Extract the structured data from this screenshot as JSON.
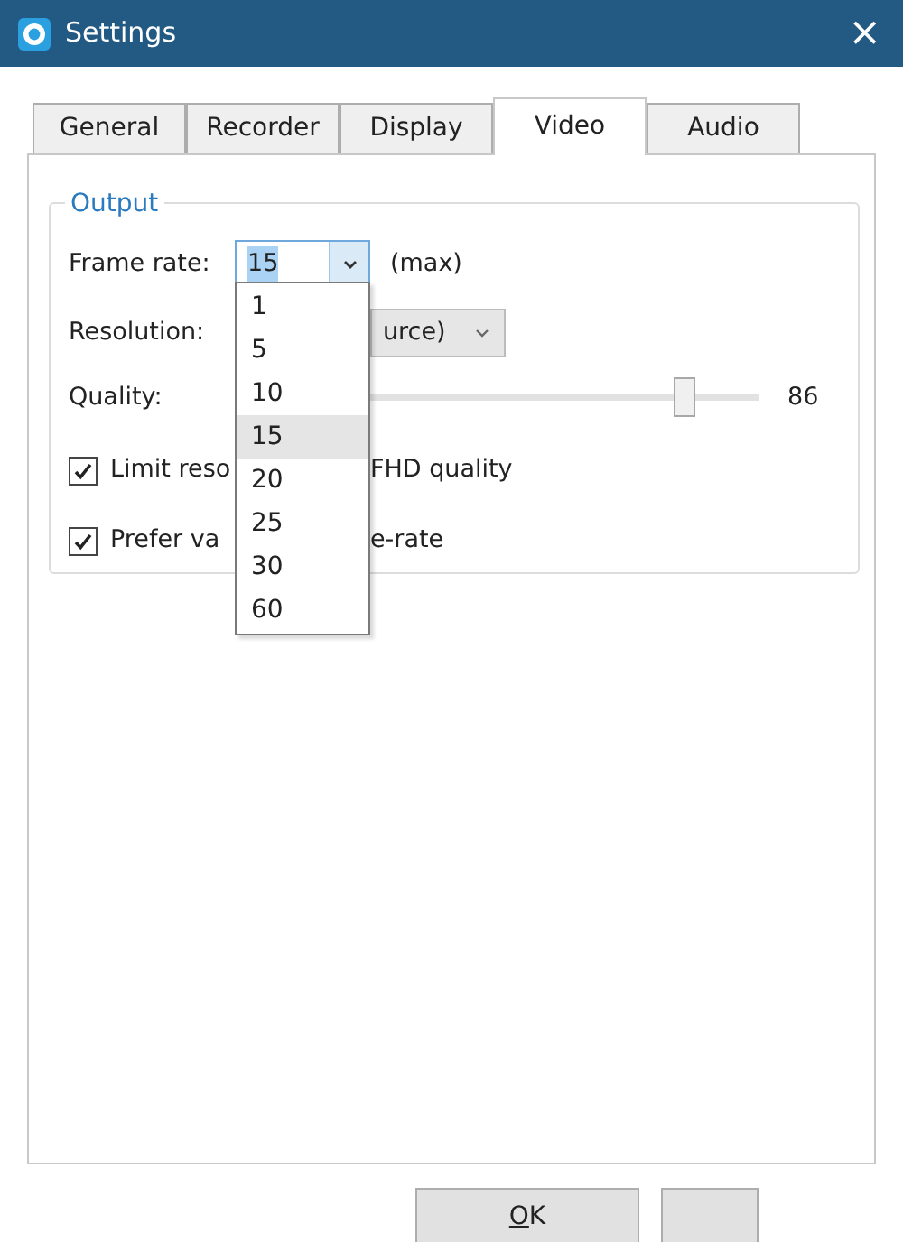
{
  "window": {
    "title": "Settings",
    "close": "×"
  },
  "tabs": [
    {
      "label": "General",
      "selected": false
    },
    {
      "label": "Recorder",
      "selected": false
    },
    {
      "label": "Display",
      "selected": false
    },
    {
      "label": "Video",
      "selected": true
    },
    {
      "label": "Audio",
      "selected": false
    }
  ],
  "output": {
    "legend": "Output",
    "frame_rate": {
      "label": "Frame rate:",
      "value": "15",
      "note": "(max)",
      "expanded": true,
      "options": [
        {
          "label": "1",
          "hovered": false
        },
        {
          "label": "5",
          "hovered": false
        },
        {
          "label": "10",
          "hovered": false
        },
        {
          "label": "15",
          "hovered": true
        },
        {
          "label": "20",
          "hovered": false
        },
        {
          "label": "25",
          "hovered": false
        },
        {
          "label": "30",
          "hovered": false
        },
        {
          "label": "60",
          "hovered": false
        }
      ]
    },
    "resolution": {
      "label": "Resolution:",
      "value": "urce)"
    },
    "quality": {
      "label": "Quality:",
      "level": 0.86,
      "reading": "86"
    },
    "checkboxes": [
      {
        "label_parts": [
          "Limit reso",
          "FHD quality"
        ],
        "checked": true
      },
      {
        "label_parts": [
          "Prefer va",
          "e-rate"
        ],
        "checked": true
      }
    ]
  },
  "buttons": [
    {
      "kind": "text",
      "label": "OK"
    },
    {
      "kind": "blank"
    }
  ]
}
